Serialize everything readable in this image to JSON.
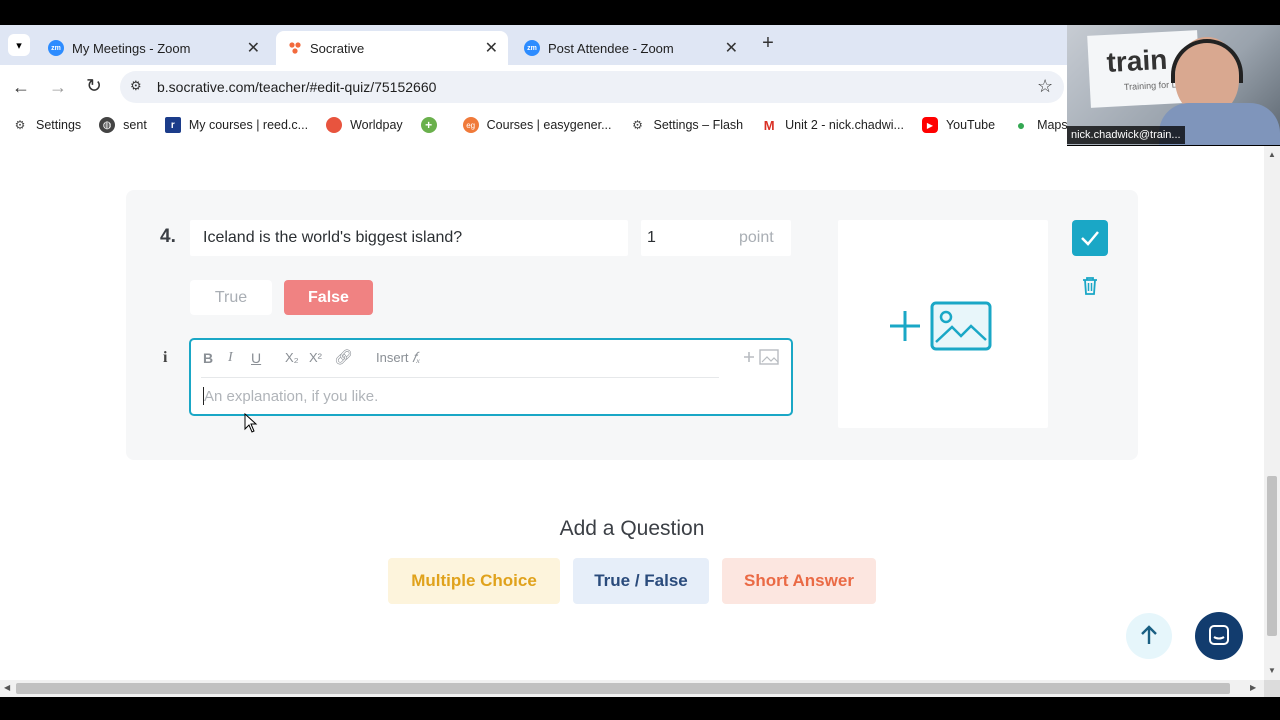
{
  "tabs": [
    {
      "label": "My Meetings - Zoom",
      "favicon": "zm"
    },
    {
      "label": "Socrative",
      "favicon": "socrative-icon"
    },
    {
      "label": "Post Attendee - Zoom",
      "favicon": "zm"
    }
  ],
  "url": "b.socrative.com/teacher/#edit-quiz/75152660",
  "bookmarks": [
    {
      "label": "Settings",
      "icon": "gear-icon"
    },
    {
      "label": "sent",
      "icon": "globe-icon"
    },
    {
      "label": "My courses | reed.c...",
      "icon": "reed-icon"
    },
    {
      "label": "Worldpay",
      "icon": "worldpay-icon"
    },
    {
      "label": "",
      "icon": "plus-circle-icon"
    },
    {
      "label": "Courses | easygener...",
      "icon": "easygenerator-icon"
    },
    {
      "label": "Settings – Flash",
      "icon": "gear-icon"
    },
    {
      "label": "Unit 2 - nick.chadwi...",
      "icon": "gmail-icon"
    },
    {
      "label": "YouTube",
      "icon": "youtube-icon"
    },
    {
      "label": "Maps",
      "icon": "maps-icon"
    }
  ],
  "video": {
    "name": "nick.chadwick@train...",
    "logo_text": "train",
    "logo_sub": "Training for Life"
  },
  "question": {
    "number": "4.",
    "text": "Iceland is the world's biggest island?",
    "points": "1",
    "points_unit": "point",
    "answer_true": "True",
    "answer_false": "False",
    "info_icon": "i",
    "toolbar": {
      "bold": "B",
      "italic": "I",
      "underline": "U",
      "sub": "X₂",
      "sup": "X²",
      "insert": "Insert"
    },
    "explanation_placeholder": "An explanation, if you like."
  },
  "add_question": {
    "title": "Add a Question",
    "buttons": [
      "Multiple Choice",
      "True / False",
      "Short Answer"
    ]
  },
  "colors": {
    "teal": "#1aa7c6",
    "false_bg": "#f08282",
    "mc_bg": "#fdf4dc",
    "mc_text": "#e0a21c",
    "tf_bg": "#e6eef9",
    "tf_text": "#2a4b7c",
    "sa_bg": "#fce6e0",
    "sa_text": "#ea6a45"
  }
}
